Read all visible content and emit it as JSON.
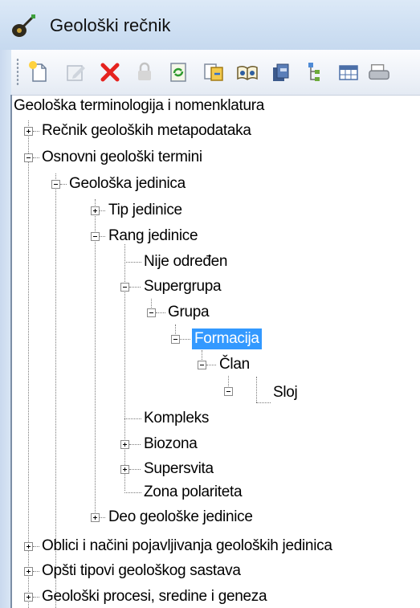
{
  "window": {
    "title": "Geološki rečnik"
  },
  "toolbar": {
    "buttons": [
      {
        "icon": "new-item-icon"
      },
      {
        "icon": "edit-icon"
      },
      {
        "icon": "delete-icon"
      },
      {
        "icon": "lock-icon"
      },
      {
        "icon": "refresh-icon"
      },
      {
        "icon": "export-icon"
      },
      {
        "icon": "book-icon"
      },
      {
        "icon": "database-icon"
      },
      {
        "icon": "tree-view-icon"
      },
      {
        "icon": "table-icon"
      },
      {
        "icon": "print-icon"
      }
    ]
  },
  "tree": {
    "root": "Geološka terminologija i nomenklatura",
    "n1": "Rečnik geoloških metapodataka",
    "n2": "Osnovni geološki termini",
    "n3": "Geološka jedinica",
    "n4": "Tip jedinice",
    "n5": "Rang jedinice",
    "n6": "Nije određen",
    "n7": "Supergrupa",
    "n8": "Grupa",
    "n9": "Formacija",
    "n10": "Član",
    "n11": "Sloj",
    "n12": "Kompleks",
    "n13": "Biozona",
    "n14": "Supersvita",
    "n15": "Zona polariteta",
    "n16": "Deo geološke jedinice",
    "n17": "Oblici i načini pojavljivanja geoloških jedinica",
    "n18": "Opšti tipovi geološkog sastava",
    "n19": "Geološki procesi, sredine i geneza",
    "selected": "Formacija"
  }
}
